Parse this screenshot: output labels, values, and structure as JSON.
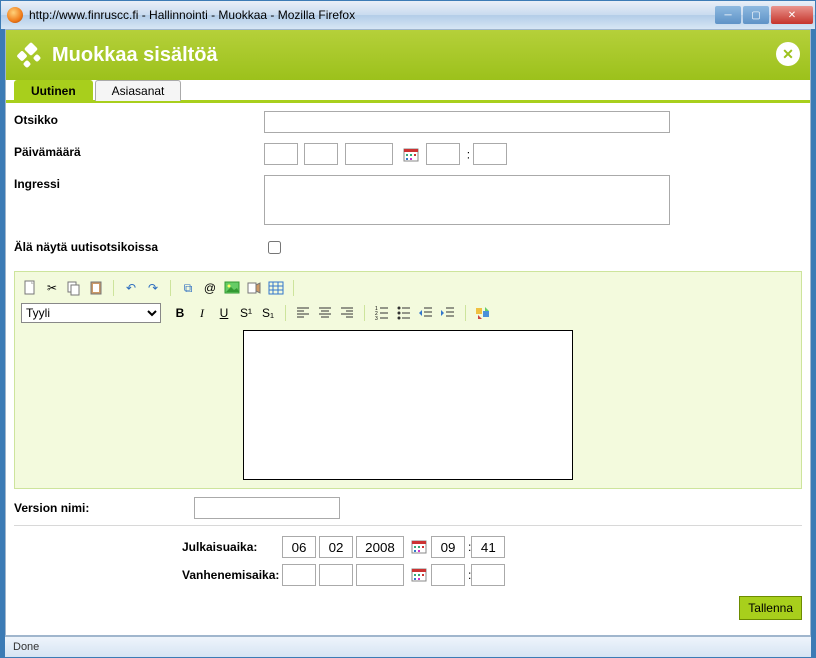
{
  "window": {
    "title": "http://www.finruscc.fi - Hallinnointi - Muokkaa - Mozilla Firefox"
  },
  "header": {
    "title": "Muokkaa sisältöä"
  },
  "tabs": [
    {
      "label": "Uutinen",
      "active": true
    },
    {
      "label": "Asiasanat",
      "active": false
    }
  ],
  "formLabels": {
    "otsikko": "Otsikko",
    "paivamaara": "Päivämäärä",
    "ingressi": "Ingressi",
    "alaNayta": "Älä näytä uutisotsikoissa",
    "versionNimi": "Version nimi:",
    "julkaisuaika": "Julkaisuaika:",
    "vanhenemisaika": "Vanhenemisaika:"
  },
  "formValues": {
    "otsikko": "",
    "dateDay": "",
    "dateMonth": "",
    "dateYear": "",
    "dateHour": "",
    "dateMin": "",
    "ingressi": "",
    "alaNayta": false,
    "versionNimi": "",
    "julkaisuDay": "06",
    "julkaisuMonth": "02",
    "julkaisuYear": "2008",
    "julkaisuHour": "09",
    "julkaisuMin": "41",
    "vanhenDay": "",
    "vanhenMonth": "",
    "vanhenYear": "",
    "vanhenHour": "",
    "vanhenMin": ""
  },
  "editor": {
    "styleLabel": "Tyyli",
    "content": ""
  },
  "buttons": {
    "save": "Tallenna"
  },
  "status": {
    "text": "Done"
  }
}
